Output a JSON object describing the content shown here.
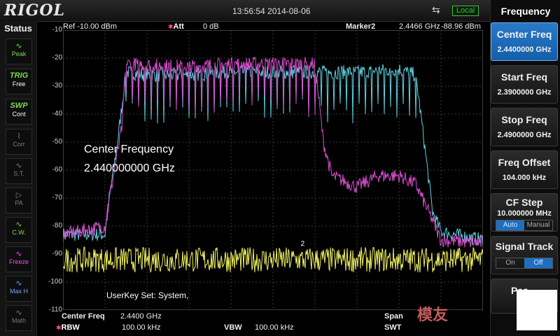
{
  "header": {
    "brand": "RIGOL",
    "time": "13:56:54 2014-08-06",
    "usb_icon": "usb-icon",
    "remote_status": "Local"
  },
  "status_panel": {
    "title": "Status",
    "items": [
      {
        "icon": "peak-icon",
        "label": "Peak",
        "state": "on"
      },
      {
        "icon": "trig-icon",
        "label": "TRIG",
        "sub": "Free",
        "state": "on"
      },
      {
        "icon": "swp-icon",
        "label": "SWP",
        "sub": "Cont",
        "state": "on"
      },
      {
        "icon": "corr-icon",
        "label": "Corr",
        "state": "off"
      },
      {
        "icon": "st-icon",
        "label": "S.T.",
        "state": "off"
      },
      {
        "icon": "pa-icon",
        "label": "PA",
        "state": "off"
      },
      {
        "icon": "cw-icon",
        "label": "C.W.",
        "state": "on"
      },
      {
        "icon": "freeze-icon",
        "label": "Freeze",
        "state": "mag"
      },
      {
        "icon": "maxh-icon",
        "label": "Max H",
        "state": "blu"
      },
      {
        "icon": "math-icon",
        "label": "Math",
        "state": "off"
      }
    ]
  },
  "measure": {
    "ref": "Ref  -10.00 dBm",
    "att_label": "Att",
    "att_value": "0 dB",
    "marker_label": "Marker2",
    "marker_freq": "2.4466 GHz",
    "marker_amp": "-88.96 dBm",
    "marker_tag": "2"
  },
  "note": {
    "line1": "Center Frequency",
    "line2": "2.440000000 GHz"
  },
  "userkey": "UserKey Set:   System,",
  "footer": {
    "center_label": "Center Freq",
    "center_value": "2.4400 GHz",
    "rbw_label": "RBW",
    "rbw_value": "100.00 kHz",
    "vbw_label": "VBW",
    "vbw_value": "100.00 kHz",
    "span_label": "Span",
    "swt_label": "SWT"
  },
  "menu": {
    "title": "Frequency",
    "center_freq": {
      "label": "Center Freq",
      "value": "2.4400000 GHz"
    },
    "start_freq": {
      "label": "Start Freq",
      "value": "2.3900000 GHz"
    },
    "stop_freq": {
      "label": "Stop Freq",
      "value": "2.4900000 GHz"
    },
    "freq_offset": {
      "label": "Freq Offset",
      "value": "104.000 kHz"
    },
    "cf_step": {
      "label": "CF Step",
      "value": "10.000000 MHz",
      "opt_a": "Auto",
      "opt_b": "Manual"
    },
    "signal_track": {
      "label": "Signal Track",
      "opt_a": "On",
      "opt_b": "Off"
    },
    "peak_partial": "Pea"
  },
  "chart_data": {
    "type": "line",
    "xlabel": "",
    "ylabel": "",
    "y_ticks": [
      "-10",
      "-20",
      "-30",
      "-40",
      "-50",
      "-60",
      "-70",
      "-80",
      "-90",
      "-100",
      "-110"
    ],
    "ylim": [
      -110,
      -10
    ],
    "x_range_ghz": [
      2.39,
      2.49
    ],
    "grid": true,
    "series": [
      {
        "color": "#5fd0e0",
        "x": [
          2.39,
          2.4,
          2.401,
          2.403,
          2.405,
          2.41,
          2.42,
          2.43,
          2.44,
          2.45,
          2.46,
          2.47,
          2.474,
          2.476,
          2.478,
          2.48,
          2.49
        ],
        "values": [
          -83,
          -83,
          -70,
          -50,
          -25,
          -26,
          -26,
          -25,
          -25,
          -25,
          -25,
          -24,
          -26,
          -50,
          -75,
          -82,
          -85
        ]
      },
      {
        "color": "#d84fd0",
        "x": [
          2.39,
          2.4,
          2.402,
          2.404,
          2.405,
          2.42,
          2.43,
          2.45,
          2.452,
          2.454,
          2.46,
          2.465,
          2.47,
          2.474,
          2.478,
          2.48,
          2.49
        ],
        "values": [
          -83,
          -80,
          -62,
          -45,
          -22,
          -23,
          -22,
          -22,
          -50,
          -62,
          -66,
          -62,
          -62,
          -65,
          -78,
          -85,
          -86
        ]
      },
      {
        "color": "#f0f060",
        "x": [
          2.39,
          2.49
        ],
        "values": [
          -92,
          -92
        ]
      }
    ]
  }
}
